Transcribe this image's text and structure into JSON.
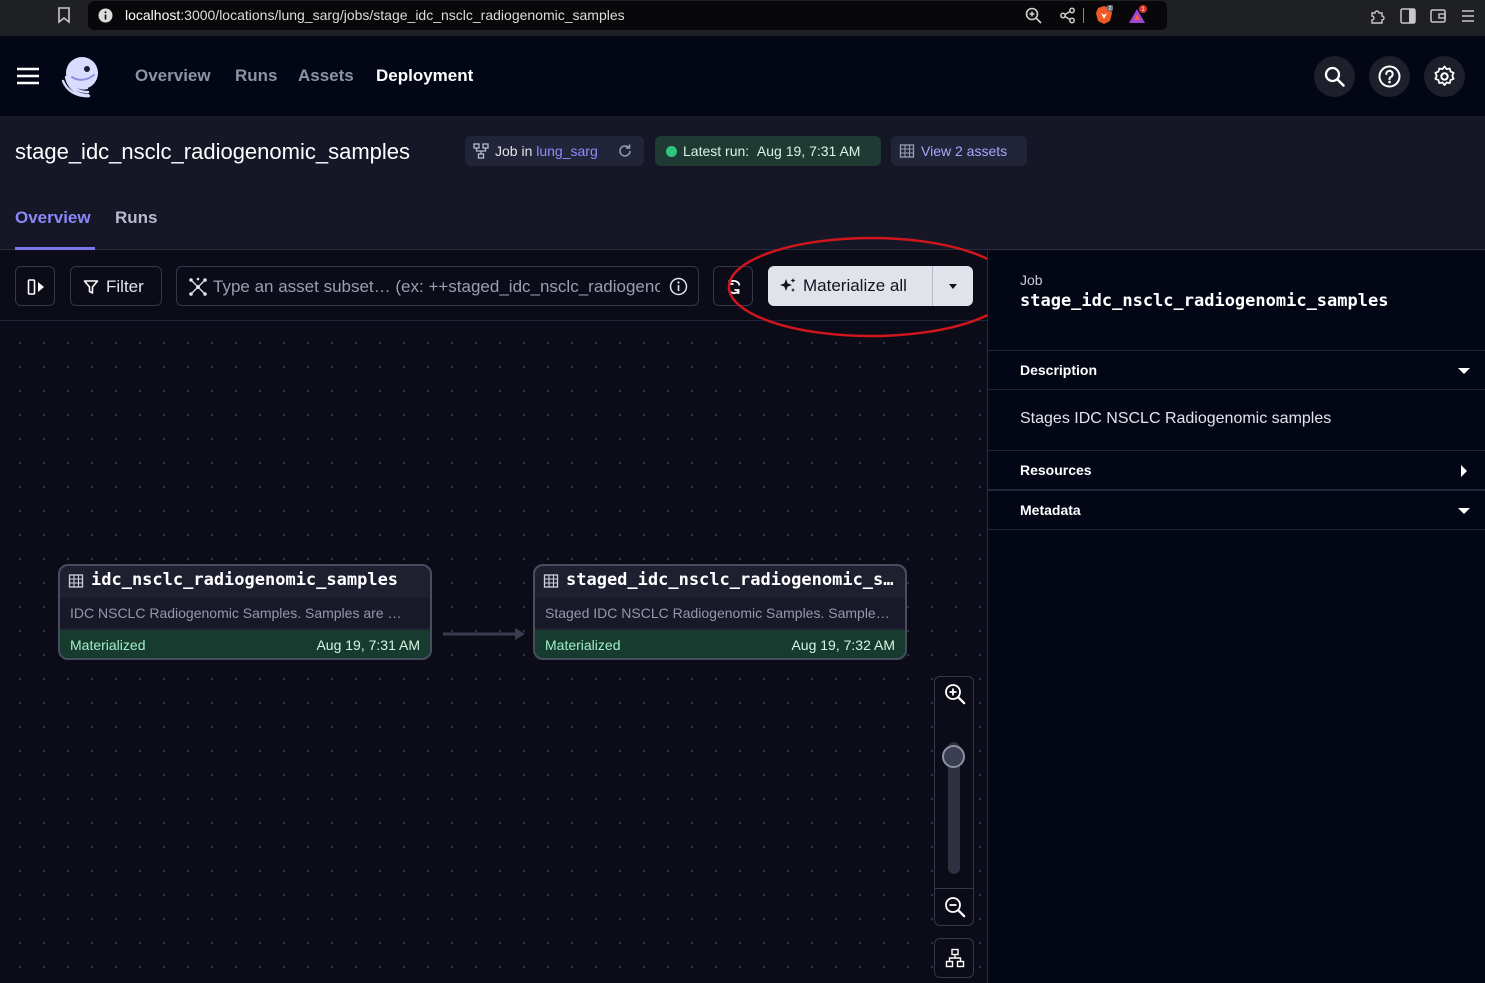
{
  "browser": {
    "url_host": "localhost",
    "url_path": ":3000/locations/lung_sarg/jobs/stage_idc_nsclc_radiogenomic_samples",
    "brave_badge": "2",
    "rewards_badge": "1"
  },
  "nav": {
    "items": [
      {
        "label": "Overview"
      },
      {
        "label": "Runs"
      },
      {
        "label": "Assets"
      },
      {
        "label": "Deployment"
      }
    ]
  },
  "page": {
    "title": "stage_idc_nsclc_radiogenomic_samples",
    "job_tag_prefix": "Job in ",
    "job_tag_repo": "lung_sarg",
    "latest_run": "Latest run:  Aug 19, 7:31 AM",
    "view_assets": "View 2 assets",
    "tabs": [
      {
        "label": "Overview",
        "active": true
      },
      {
        "label": "Runs",
        "active": false
      }
    ]
  },
  "toolbar": {
    "filter_label": "Filter",
    "search_placeholder": "Type an asset subset… (ex: ++staged_idc_nsclc_radiogenomic_samples)",
    "materialize_label": "Materialize all"
  },
  "graph": {
    "nodes": [
      {
        "name": "idc_nsclc_radiogenomic_samples",
        "description": "IDC NSCLC Radiogenomic Samples. Samples are …",
        "status": "Materialized",
        "timestamp": "Aug 19, 7:31 AM"
      },
      {
        "name": "staged_idc_nsclc_radiogenomic_samples",
        "description": "Staged IDC NSCLC Radiogenomic Samples. Samples are extracted from IDC",
        "status": "Materialized",
        "timestamp": "Aug 19, 7:32 AM"
      }
    ]
  },
  "sidebar": {
    "label": "Job",
    "title": "stage_idc_nsclc_radiogenomic_samples",
    "sections": [
      {
        "label": "Description",
        "expanded": true
      },
      {
        "label": "Resources",
        "expanded": false
      },
      {
        "label": "Metadata",
        "expanded": true
      }
    ],
    "description_text": "Stages IDC NSCLC Radiogenomic samples"
  },
  "colors": {
    "accent": "#7b78f0",
    "success": "#31c480",
    "annotation": "#d0161c"
  }
}
